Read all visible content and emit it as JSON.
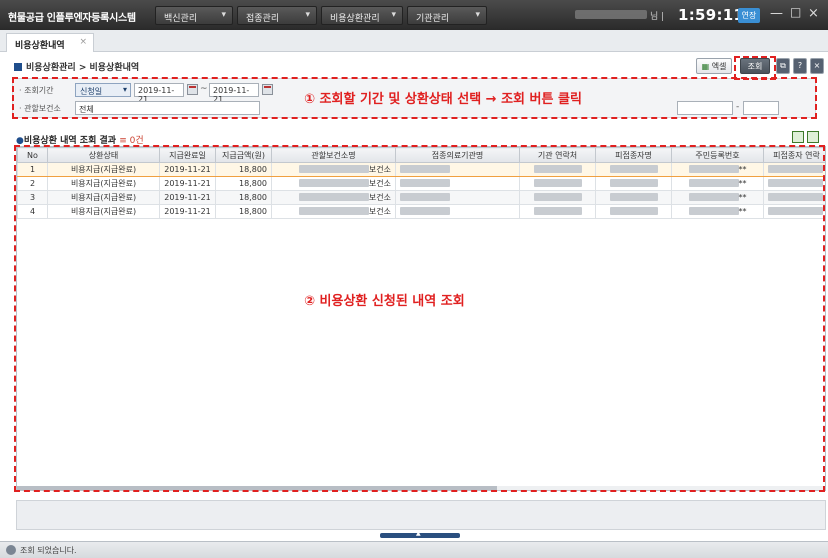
{
  "app": {
    "title": "현물공급 인플루엔자등록시스템",
    "menus": [
      {
        "label": "백신관리"
      },
      {
        "label": "접종관리"
      },
      {
        "label": "비용상환관리"
      },
      {
        "label": "기관관리"
      }
    ],
    "user_suffix": "님 |",
    "clock": "1:59:11",
    "extend_label": "연장"
  },
  "tab": {
    "label": "비용상환내역",
    "close": "×"
  },
  "breadcrumb": "비용상환관리 > 비용상환내역",
  "toolbar": {
    "excel_label": "엑셀",
    "query_label": "조회"
  },
  "search": {
    "period_label": "· 조회기간",
    "period_type": "신청일",
    "date_from": "2019-11-21",
    "tilde": "~",
    "date_to": "2019-11-21",
    "health_center_label": "· 관할보건소",
    "health_center_value": "전체",
    "dash": "-"
  },
  "annotations": {
    "one": "① 조회할 기간 및 상환상태 선택 → 조회 버튼 클릭",
    "two": "② 비용상환 신청된 내역 조회"
  },
  "results": {
    "title": "비용상환 내역 조회 결과",
    "count": "≡ 0건",
    "columns": [
      "No",
      "상환상태",
      "지급완료일",
      "지급금액(원)",
      "관할보건소명",
      "접종의료기관명",
      "기관 연락처",
      "피접종자명",
      "주민등록번호",
      "피접종자 연락"
    ],
    "rows": [
      {
        "no": "1",
        "status": "비용지급(지급완료)",
        "date": "2019-11-21",
        "amount": "18,800",
        "center": "보건소",
        "rrn_mark": "**"
      },
      {
        "no": "2",
        "status": "비용지급(지급완료)",
        "date": "2019-11-21",
        "amount": "18,800",
        "center": "보건소",
        "rrn_mark": "**"
      },
      {
        "no": "3",
        "status": "비용지급(지급완료)",
        "date": "2019-11-21",
        "amount": "18,800",
        "center": "보건소",
        "rrn_mark": "**"
      },
      {
        "no": "4",
        "status": "비용지급(지급완료)",
        "date": "2019-11-21",
        "amount": "18,800",
        "center": "보건소",
        "rrn_mark": "**"
      }
    ]
  },
  "status_bar": {
    "text": "조회 되었습니다."
  },
  "colors": {
    "annotation": "#e02020",
    "accent": "#1f4e8c",
    "selected_row": "#fff7e6"
  }
}
